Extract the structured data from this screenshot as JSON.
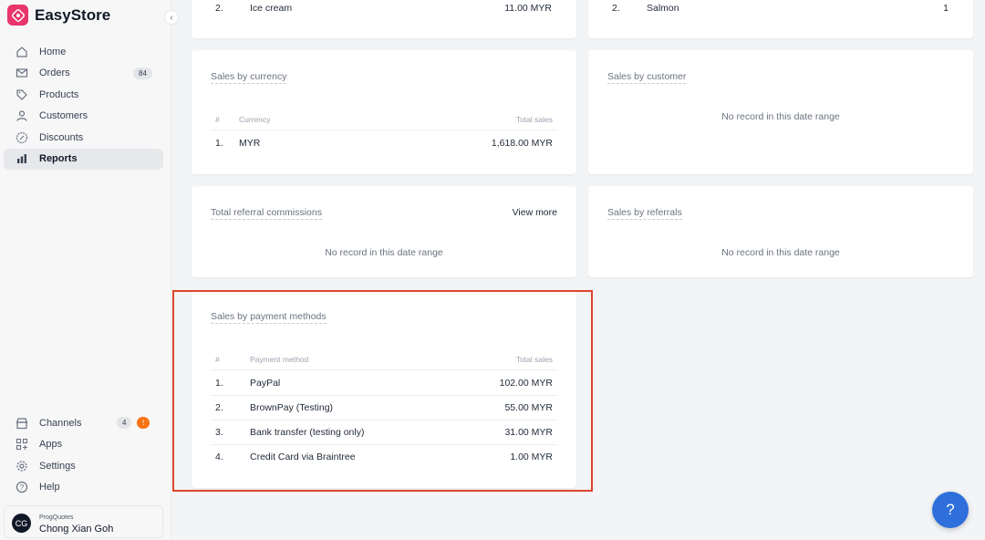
{
  "brand": {
    "name": "EasyStore"
  },
  "colors": {
    "brand": "#e8356b",
    "accent": "#2f6fdb",
    "highlight": "#e0452b",
    "badge_orange": "#f97316"
  },
  "sidebar": {
    "collapse_icon": "chevron-left-icon",
    "items": [
      {
        "label": "Home",
        "icon": "home-icon"
      },
      {
        "label": "Orders",
        "icon": "mail-icon",
        "badge": "84"
      },
      {
        "label": "Products",
        "icon": "tag-icon"
      },
      {
        "label": "Customers",
        "icon": "person-icon"
      },
      {
        "label": "Discounts",
        "icon": "discount-icon"
      },
      {
        "label": "Reports",
        "icon": "bar-chart-icon",
        "active": true
      }
    ],
    "bottom_items": [
      {
        "label": "Channels",
        "icon": "store-icon",
        "badge": "4",
        "badge2": "!"
      },
      {
        "label": "Apps",
        "icon": "apps-icon"
      },
      {
        "label": "Settings",
        "icon": "gear-icon"
      },
      {
        "label": "Help",
        "icon": "question-icon"
      }
    ],
    "user": {
      "store": "ProgQuotes",
      "name": "Chong Xian Goh",
      "initials": "CG"
    }
  },
  "top_partial": {
    "left": {
      "index": "2.",
      "name": "Ice cream",
      "value": "11.00 MYR"
    },
    "right": {
      "index": "2.",
      "name": "Salmon",
      "value": "1"
    }
  },
  "sales_by_currency": {
    "title": "Sales by currency",
    "headers": {
      "index": "#",
      "currency": "Currency",
      "total": "Total sales"
    },
    "rows": [
      {
        "index": "1.",
        "currency": "MYR",
        "total": "1,618.00 MYR"
      }
    ]
  },
  "sales_by_customer": {
    "title": "Sales by customer",
    "empty": "No record in this date range"
  },
  "referral_commissions": {
    "title": "Total referral commissions",
    "link": "View more",
    "empty": "No record in this date range"
  },
  "sales_by_referrals": {
    "title": "Sales by referrals",
    "empty": "No record in this date range"
  },
  "sales_by_payment": {
    "title": "Sales by payment methods",
    "headers": {
      "index": "#",
      "method": "Payment method",
      "total": "Total sales"
    },
    "rows": [
      {
        "index": "1.",
        "method": "PayPal",
        "total": "102.00 MYR"
      },
      {
        "index": "2.",
        "method": "BrownPay (Testing)",
        "total": "55.00 MYR"
      },
      {
        "index": "3.",
        "method": "Bank transfer (testing only)",
        "total": "31.00 MYR"
      },
      {
        "index": "4.",
        "method": "Credit Card via Braintree",
        "total": "1.00 MYR"
      }
    ]
  },
  "help_button": {
    "label": "?"
  }
}
